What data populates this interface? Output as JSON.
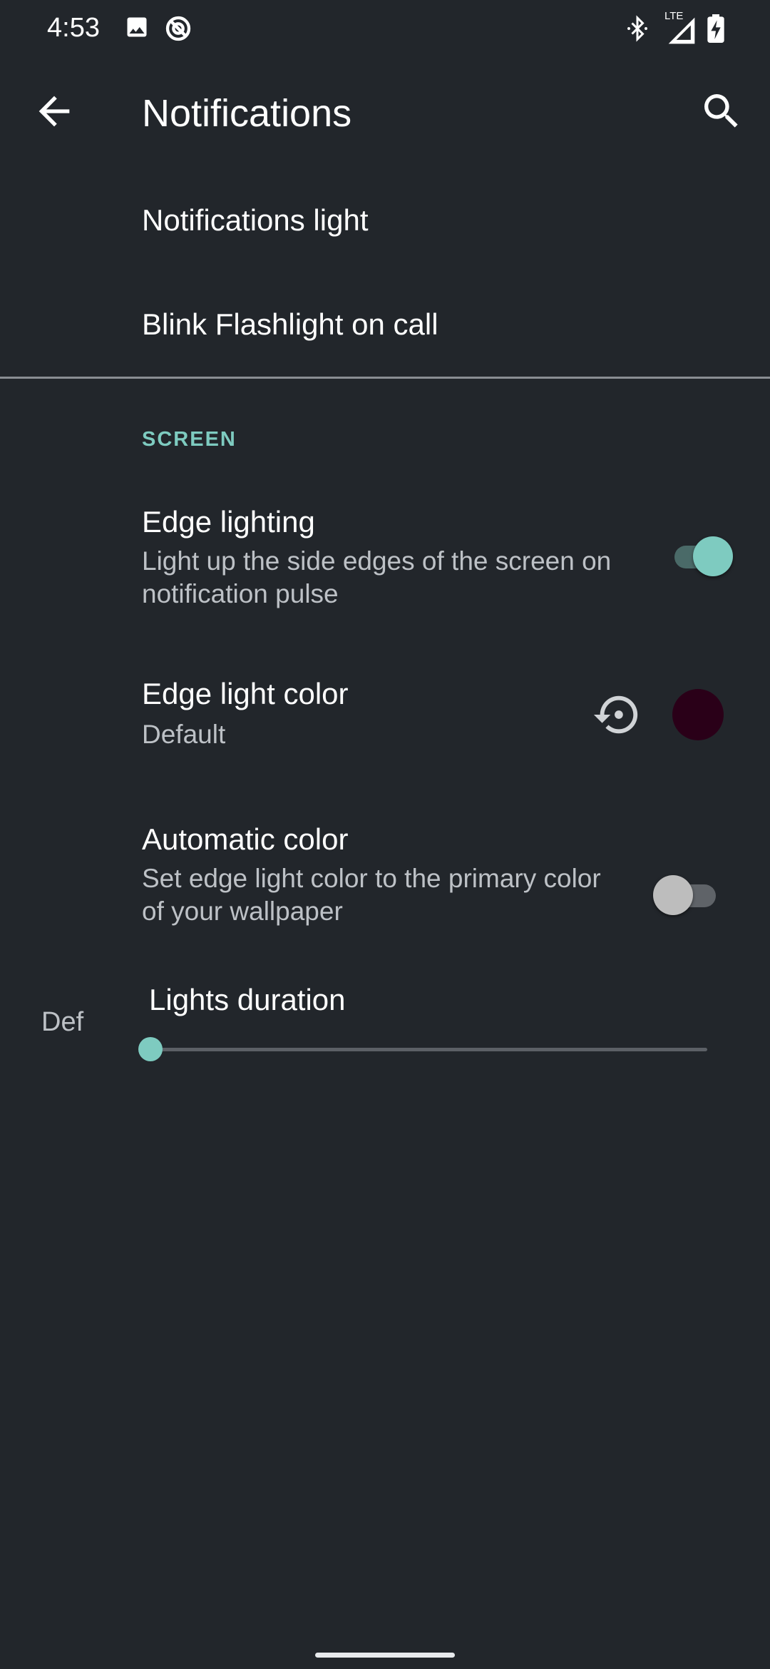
{
  "status_bar": {
    "time": "4:53",
    "icons": [
      "image-icon",
      "data-saver-icon",
      "bluetooth-icon",
      "lte-signal-icon",
      "battery-charging-icon"
    ],
    "network_label": "LTE"
  },
  "app_bar": {
    "title": "Notifications",
    "back_icon": "arrow-back-icon",
    "search_icon": "search-icon"
  },
  "top_items": [
    {
      "title": "Notifications light"
    },
    {
      "title": "Blink Flashlight on call"
    }
  ],
  "section": {
    "header": "SCREEN",
    "edge_lighting": {
      "title": "Edge lighting",
      "summary": "Light up the side edges of the screen on notification pulse",
      "enabled": true
    },
    "edge_light_color": {
      "title": "Edge light color",
      "summary": "Default",
      "swatch_color": "#2a0018",
      "reset_icon": "restore-icon"
    },
    "automatic_color": {
      "title": "Automatic color",
      "summary": "Set edge light color to the primary color of your wallpaper",
      "enabled": false
    },
    "lights_duration": {
      "label": "Lights duration",
      "value": "Def",
      "fraction": 0.0
    }
  },
  "colors": {
    "background": "#22262b",
    "accent": "#7ecbc0",
    "accent_track": "#4a6a68",
    "off_thumb": "#bdbdbd",
    "off_track": "#5f6368"
  }
}
